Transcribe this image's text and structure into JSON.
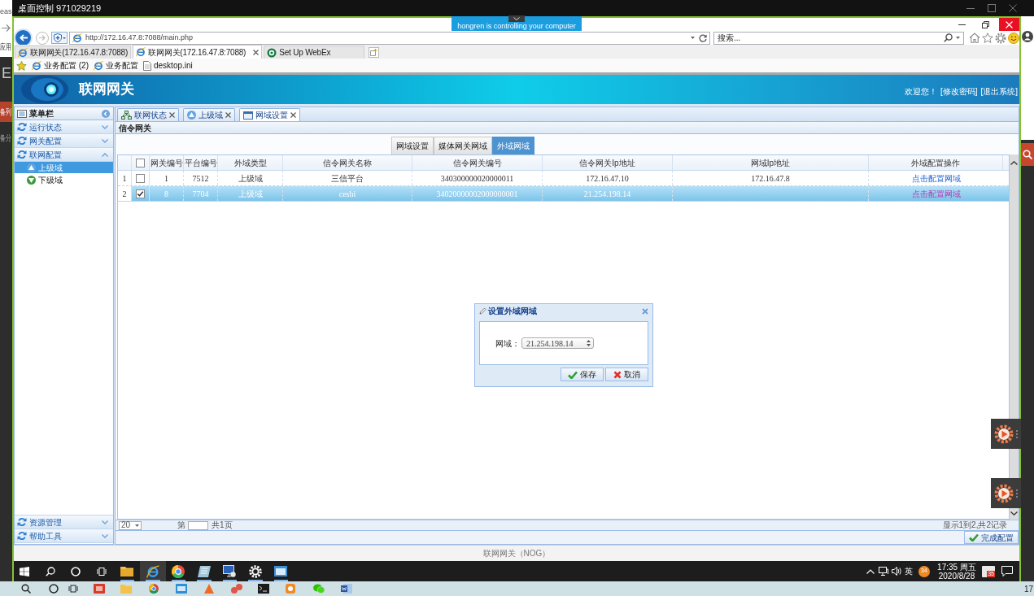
{
  "host": {
    "title": "桌面控制 971029219",
    "left_edge_texts": [
      "eas",
      "应用",
      "E",
      "备列",
      "备分"
    ],
    "taskbar_clock": "17"
  },
  "remote_notice": "hongren is controlling your computer",
  "browser": {
    "address": "http://172.16.47.8:7088/main.php",
    "search_placeholder": "搜索...",
    "tabs": [
      {
        "label": "联网网关(172.16.47.8:7088)",
        "kind": "e",
        "selected": false
      },
      {
        "label": "联网网关(172.16.47.8:7088)",
        "kind": "e",
        "selected": true
      },
      {
        "label": "Set Up WebEx",
        "kind": "ring",
        "selected": false
      }
    ],
    "favorites": [
      {
        "label": "业务配置 (2)",
        "kind": "page"
      },
      {
        "label": "业务配置",
        "kind": "page"
      },
      {
        "label": "desktop.ini",
        "kind": "file"
      }
    ]
  },
  "app": {
    "title": "联网网关",
    "welcome": "欢迎您！",
    "header_links": [
      "[修改密码]",
      "[退出系统]"
    ],
    "sidebar": {
      "title": "菜单栏",
      "items": [
        {
          "label": "运行状态",
          "expanded": false
        },
        {
          "label": "网关配置",
          "expanded": false
        },
        {
          "label": "联网配置",
          "expanded": true,
          "children": [
            {
              "label": "上级域",
              "kind": "up",
              "selected": true
            },
            {
              "label": "下级域",
              "kind": "down",
              "selected": false
            }
          ]
        }
      ],
      "bottom_items": [
        {
          "label": "资源管理",
          "expanded": false
        },
        {
          "label": "帮助工具",
          "expanded": false
        }
      ]
    },
    "tabs": [
      {
        "label": "联网状态",
        "kind": "network",
        "selected": false
      },
      {
        "label": "上级域",
        "kind": "up",
        "selected": false
      },
      {
        "label": "网域设置",
        "kind": "window",
        "selected": true
      }
    ],
    "breadcrumb": "信令网关",
    "sub_tabs": [
      {
        "label": "网域设置",
        "selected": false
      },
      {
        "label": "媒体网关网域",
        "selected": false
      },
      {
        "label": "外域网域",
        "selected": true
      }
    ],
    "table": {
      "select_all_checked": false,
      "columns": [
        "网关编号",
        "平台编号",
        "外域类型",
        "信令网关名称",
        "信令网关编号",
        "信令网关Ip地址",
        "网域Ip地址",
        "外域配置操作"
      ],
      "rows": [
        {
          "row_number": "1",
          "checked": false,
          "selected": false,
          "gateway_no": "1",
          "platform_no": "7512",
          "domain_type": "上级域",
          "name": "三信平台",
          "code": "340300000020000011",
          "signal_ip": "172.16.47.10",
          "domain_ip": "172.16.47.8",
          "action": "点击配置网域",
          "visited": false
        },
        {
          "row_number": "2",
          "checked": true,
          "selected": true,
          "gateway_no": "8",
          "platform_no": "7704",
          "domain_type": "上级域",
          "name": "ceshi",
          "code": "34020000002000000001",
          "signal_ip": "21.254.198.14",
          "action": "点击配置网域",
          "visited": true
        }
      ]
    },
    "pagination": {
      "page_size": "20",
      "page_prefix": "第",
      "page_total": "共1页",
      "summary": "显示1到2,共2记录"
    },
    "finish_button": "完成配置",
    "footer": "联网网关（NOG）",
    "dialog": {
      "title": "设置外域网域",
      "field_label": "网域：",
      "field_value": "21.254.198.14",
      "buttons": [
        {
          "label": "保存",
          "kind": "confirm"
        },
        {
          "label": "取消",
          "kind": "cancel"
        }
      ]
    }
  },
  "taskbar": {
    "apps": [
      {
        "kind": "folder",
        "active": false
      },
      {
        "kind": "e",
        "active": true
      },
      {
        "kind": "wheel",
        "active": false
      },
      {
        "kind": "notes",
        "active": false
      },
      {
        "kind": "remote",
        "active": false
      },
      {
        "kind": "gear",
        "active": false
      },
      {
        "kind": "window",
        "active": false
      }
    ],
    "input_method": "英",
    "tray_badge": "34",
    "time": "17:35 周五",
    "date": "2020/8/28",
    "notification_count": "35"
  }
}
